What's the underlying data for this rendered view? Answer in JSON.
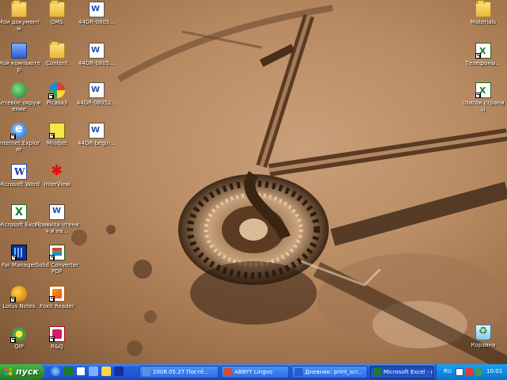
{
  "desktop": {
    "icons": [
      {
        "id": "my-documents",
        "label": "Мои документы",
        "type": "folder"
      },
      {
        "id": "oms",
        "label": "OMS",
        "type": "folder"
      },
      {
        "id": "doc-44dr-0805",
        "label": "44DR-0805...",
        "type": "doc"
      },
      {
        "id": "my-computer",
        "label": "Мой компьютер",
        "type": "computer"
      },
      {
        "id": "content",
        "label": "Content",
        "type": "folder"
      },
      {
        "id": "doc-44dr-0805-b",
        "label": "44DR-0805...",
        "type": "doc"
      },
      {
        "id": "network",
        "label": "Сетевое окружение",
        "type": "network"
      },
      {
        "id": "picasa",
        "label": "Picasa3",
        "type": "picasa"
      },
      {
        "id": "doc-44dr-08052",
        "label": "44DR-08052...",
        "type": "doc"
      },
      {
        "id": "internet-explorer",
        "label": "Internet Explorer",
        "type": "ie"
      },
      {
        "id": "mindjet",
        "label": "MindJet",
        "type": "mindjet"
      },
      {
        "id": "doc-44dr-begin",
        "label": "44DR-begin...",
        "type": "doc"
      },
      {
        "id": "microsoft-word",
        "label": "Microsoft Word",
        "type": "word"
      },
      {
        "id": "interview",
        "label": "InterView",
        "type": "interview"
      },
      {
        "id": "microsoft-excel",
        "label": "Microsoft Excel",
        "type": "excel"
      },
      {
        "id": "pravila",
        "label": "Правила чтения и на...",
        "type": "fileshare"
      },
      {
        "id": "far-manager",
        "label": "Far Manager",
        "type": "far"
      },
      {
        "id": "solid-converter",
        "label": "Solid Converter PDF",
        "type": "pdf"
      },
      {
        "id": "lotus-notes",
        "label": "Lotus Notes",
        "type": "notes"
      },
      {
        "id": "foxit-reader",
        "label": "Foxit Reader",
        "type": "foxit"
      },
      {
        "id": "qip",
        "label": "QIP",
        "type": "qip"
      },
      {
        "id": "rq",
        "label": "R&Q",
        "type": "rq"
      },
      {
        "id": "materials",
        "label": "Materials",
        "type": "folder"
      },
      {
        "id": "telefony",
        "label": "Телефоны...",
        "type": "xls"
      },
      {
        "id": "spisok-stranits",
        "label": "список страниц",
        "type": "xls"
      },
      {
        "id": "recycle-bin",
        "label": "Корзина",
        "type": "bin"
      }
    ]
  },
  "taskbar": {
    "start_label": "пуск",
    "tasks": [
      {
        "label": "2008.05.27 Постё...",
        "icon_color": "#5a8fe0",
        "active": false
      },
      {
        "label": "ABBYY Lingvo",
        "icon_color": "#d84a2a",
        "active": false
      },
      {
        "label": "Дневник: print_scr...",
        "icon_color": "#2a5bd0",
        "active": false
      },
      {
        "label": "Microsoft Excel - сп...",
        "icon_color": "#1d7a2e",
        "active": true
      }
    ],
    "tray": {
      "language": "RU",
      "clock": "10:01"
    }
  },
  "colors": {
    "taskbar": "#245edb",
    "start": "#2e8f2e",
    "tray": "#0f86e0"
  }
}
